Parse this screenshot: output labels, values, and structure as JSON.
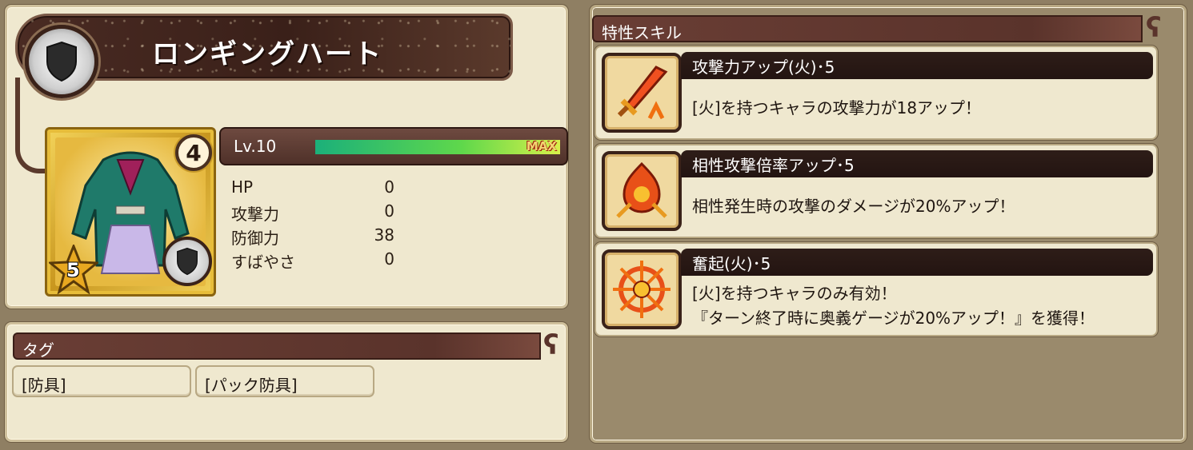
{
  "item": {
    "name": "ロンギングハート",
    "rarity": "4",
    "stars": "5",
    "level_label": "Lv.10",
    "level_max_label": "MAX",
    "level_progress": 1.0,
    "type_icon": "shield-icon",
    "stats": [
      {
        "name": "HP",
        "value": "0"
      },
      {
        "name": "攻撃力",
        "value": "0"
      },
      {
        "name": "防御力",
        "value": "38"
      },
      {
        "name": "すばやさ",
        "value": "0"
      }
    ]
  },
  "tags": {
    "header": "タグ",
    "items": [
      "[防具]",
      "[パック防具]"
    ]
  },
  "skills": {
    "header": "特性スキル",
    "items": [
      {
        "name": "攻撃力アップ(火)･5",
        "icon": "fire-sword-up-icon",
        "lines": [
          "[火]を持つキャラの攻撃力が18アップ！"
        ]
      },
      {
        "name": "相性攻撃倍率アップ･5",
        "icon": "fire-affinity-up-icon",
        "lines": [
          "相性発生時の攻撃のダメージが20%アップ！"
        ]
      },
      {
        "name": "奮起(火)･5",
        "icon": "fire-rally-icon",
        "lines": [
          "[火]を持つキャラのみ有効！",
          "『ターン終了時に奥義ゲージが20%アップ！』を獲得！"
        ]
      }
    ]
  },
  "colors": {
    "panel": "#efe8cf",
    "header": "#5a332b",
    "skill_bar": "#231411",
    "level_fill_start": "#1bb07a",
    "level_fill_end": "#d8f04a"
  }
}
